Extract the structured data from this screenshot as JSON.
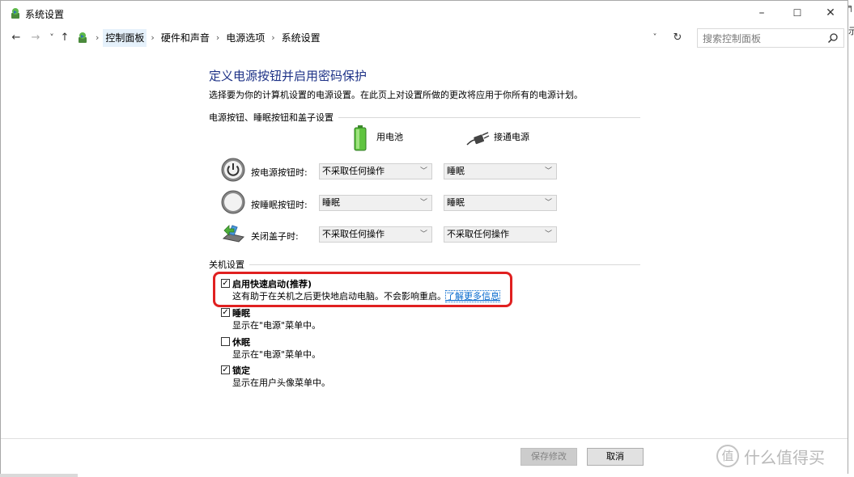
{
  "window": {
    "title": "系统设置",
    "controls": {
      "minimize": "–",
      "maximize": "☐",
      "close": "✕"
    }
  },
  "nav": {
    "back": "←",
    "forward": "→",
    "recent": "˅",
    "up": "↑"
  },
  "breadcrumb": {
    "items": [
      "控制面板",
      "硬件和声音",
      "电源选项",
      "系统设置"
    ],
    "separator": "›"
  },
  "address": {
    "dropdown": "˅",
    "refresh": "↻"
  },
  "search": {
    "placeholder": "搜索控制面板"
  },
  "page": {
    "title": "定义电源按钮并启用密码保护",
    "description": "选择要为你的计算机设置的电源设置。在此页上对设置所做的更改将应用于你所有的电源计划。"
  },
  "power_section": {
    "heading": "电源按钮、睡眠按钮和盖子设置",
    "columns": {
      "battery": "用电池",
      "plugged_in": "接通电源"
    },
    "rows": [
      {
        "label": "按电源按钮时:",
        "battery": "不采取任何操作",
        "plugged_in": "睡眠"
      },
      {
        "label": "按睡眠按钮时:",
        "battery": "睡眠",
        "plugged_in": "睡眠"
      },
      {
        "label": "关闭盖子时:",
        "battery": "不采取任何操作",
        "plugged_in": "不采取任何操作"
      }
    ]
  },
  "shutdown_section": {
    "heading": "关机设置",
    "options": [
      {
        "label": "启用快速启动(推荐)",
        "desc": "这有助于在关机之后更快地启动电脑。不会影响重启。",
        "link": "了解更多信息",
        "checked": true,
        "check_mark": "✓"
      },
      {
        "label": "睡眠",
        "desc": "显示在\"电源\"菜单中。",
        "checked": true,
        "check_mark": "✓"
      },
      {
        "label": "休眠",
        "desc": "显示在\"电源\"菜单中。",
        "checked": false,
        "check_mark": ""
      },
      {
        "label": "锁定",
        "desc": "显示在用户头像菜单中。",
        "checked": true,
        "check_mark": "✓"
      }
    ]
  },
  "footer": {
    "save": "保存修改",
    "cancel": "取消"
  },
  "watermark": {
    "logo": "值",
    "text": "什么值得买"
  },
  "edge": {
    "top_char": "╕",
    "second_char": "示"
  },
  "colors": {
    "title_blue": "#1e3287",
    "highlight_red": "#e02020",
    "link_blue": "#0066cc"
  }
}
